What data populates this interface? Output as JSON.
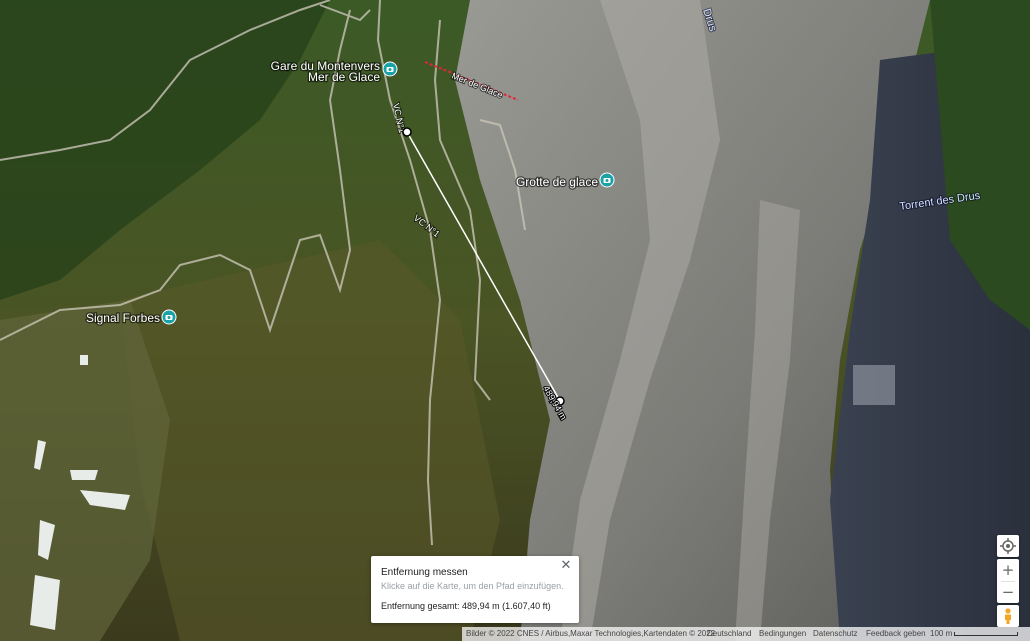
{
  "map": {
    "type": "satellite",
    "pois": [
      {
        "id": "montenvers",
        "lines": [
          "Gare du Montenvers",
          "Mer de Glace"
        ],
        "icon": "camera-pin-icon"
      },
      {
        "id": "grotte",
        "lines": [
          "Grotte de glace"
        ],
        "icon": "camera-pin-icon"
      },
      {
        "id": "forbes",
        "lines": [
          "Signal Forbes"
        ],
        "icon": "camera-pin-icon"
      }
    ],
    "labels": {
      "mer_de_glace_line": "Mer de Glace",
      "road_vcn1_upper": "VC N°1",
      "road_vcn1_lower": "VC N°1",
      "torrent": "Torrent des Drus",
      "top_river": "Drus"
    },
    "measurement": {
      "segment_label": "489,94 m",
      "line_color": "#ffffff"
    },
    "colors": {
      "poi_pin": "#1ba1a8",
      "cable_line": "#e0263a"
    }
  },
  "distance_panel": {
    "title": "Entfernung messen",
    "hint": "Klicke auf die Karte, um den Pfad einzufügen.",
    "total": "Entfernung gesamt: 489,94 m (1.607,40 ft)",
    "close_label": "✕"
  },
  "controls": {
    "zoom_in": "+",
    "zoom_out": "−"
  },
  "footer": {
    "imagery": "Bilder © 2022 CNES / Airbus,Maxar Technologies,Kartendaten © 2022",
    "country": "Deutschland",
    "terms": "Bedingungen",
    "privacy": "Datenschutz",
    "feedback": "Feedback geben",
    "scale": "100 m"
  }
}
